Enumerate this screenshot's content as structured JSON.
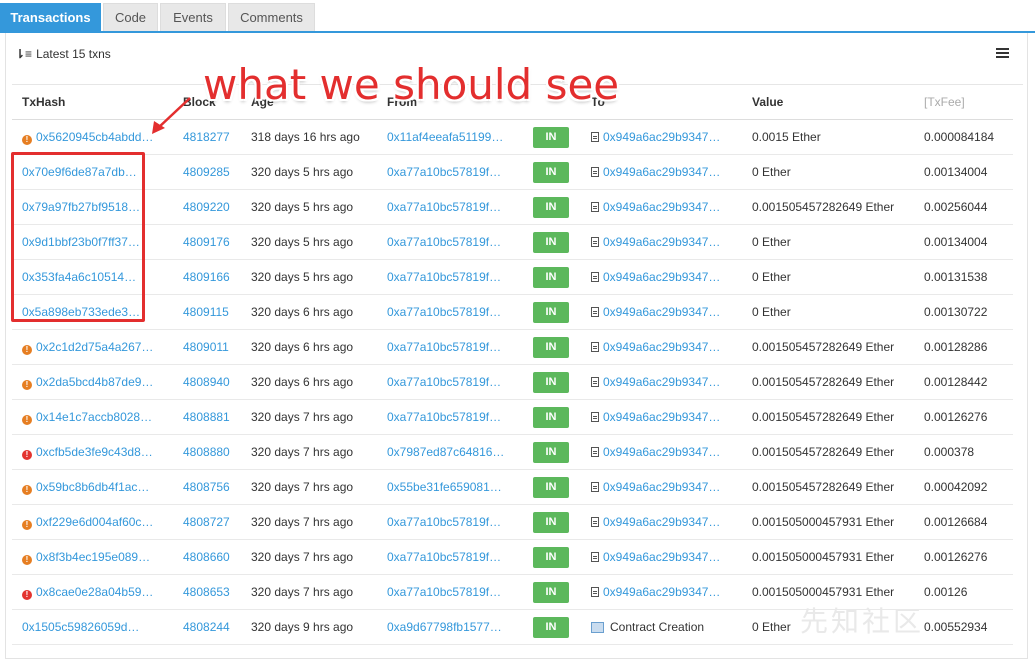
{
  "tabs": [
    {
      "label": "Transactions",
      "active": true
    },
    {
      "label": "Code",
      "active": false
    },
    {
      "label": "Events",
      "active": false
    },
    {
      "label": "Comments",
      "active": false
    }
  ],
  "latest_label": "Latest 15 txns",
  "columns": [
    "TxHash",
    "Block",
    "Age",
    "From",
    "",
    "To",
    "Value",
    "[TxFee]"
  ],
  "rows": [
    {
      "status": "orange",
      "hash": "0x5620945cb4abdd…",
      "block": "4818277",
      "age": "318 days 16 hrs ago",
      "from": "0x11af4eeafa51199…",
      "dir": "IN",
      "to": "0x949a6ac29b9347…",
      "value": "0.0015 Ether",
      "fee": "0.000084184"
    },
    {
      "status": "",
      "hash": "0x70e9f6de87a7db…",
      "block": "4809285",
      "age": "320 days 5 hrs ago",
      "from": "0xa77a10bc57819f…",
      "dir": "IN",
      "to": "0x949a6ac29b9347…",
      "value": "0 Ether",
      "fee": "0.00134004"
    },
    {
      "status": "",
      "hash": "0x79a97fb27bf9518…",
      "block": "4809220",
      "age": "320 days 5 hrs ago",
      "from": "0xa77a10bc57819f…",
      "dir": "IN",
      "to": "0x949a6ac29b9347…",
      "value": "0.001505457282649 Ether",
      "fee": "0.00256044"
    },
    {
      "status": "",
      "hash": "0x9d1bbf23b0f7ff37…",
      "block": "4809176",
      "age": "320 days 5 hrs ago",
      "from": "0xa77a10bc57819f…",
      "dir": "IN",
      "to": "0x949a6ac29b9347…",
      "value": "0 Ether",
      "fee": "0.00134004"
    },
    {
      "status": "",
      "hash": "0x353fa4a6c10514…",
      "block": "4809166",
      "age": "320 days 5 hrs ago",
      "from": "0xa77a10bc57819f…",
      "dir": "IN",
      "to": "0x949a6ac29b9347…",
      "value": "0 Ether",
      "fee": "0.00131538"
    },
    {
      "status": "",
      "hash": "0x5a898eb733ede3…",
      "block": "4809115",
      "age": "320 days 6 hrs ago",
      "from": "0xa77a10bc57819f…",
      "dir": "IN",
      "to": "0x949a6ac29b9347…",
      "value": "0 Ether",
      "fee": "0.00130722"
    },
    {
      "status": "orange",
      "hash": "0x2c1d2d75a4a267…",
      "block": "4809011",
      "age": "320 days 6 hrs ago",
      "from": "0xa77a10bc57819f…",
      "dir": "IN",
      "to": "0x949a6ac29b9347…",
      "value": "0.001505457282649 Ether",
      "fee": "0.00128286"
    },
    {
      "status": "orange",
      "hash": "0x2da5bcd4b87de9…",
      "block": "4808940",
      "age": "320 days 6 hrs ago",
      "from": "0xa77a10bc57819f…",
      "dir": "IN",
      "to": "0x949a6ac29b9347…",
      "value": "0.001505457282649 Ether",
      "fee": "0.00128442"
    },
    {
      "status": "orange",
      "hash": "0x14e1c7accb8028…",
      "block": "4808881",
      "age": "320 days 7 hrs ago",
      "from": "0xa77a10bc57819f…",
      "dir": "IN",
      "to": "0x949a6ac29b9347…",
      "value": "0.001505457282649 Ether",
      "fee": "0.00126276"
    },
    {
      "status": "red",
      "hash": "0xcfb5de3fe9c43d8…",
      "block": "4808880",
      "age": "320 days 7 hrs ago",
      "from": "0x7987ed87c64816…",
      "dir": "IN",
      "to": "0x949a6ac29b9347…",
      "value": "0.001505457282649 Ether",
      "fee": "0.000378"
    },
    {
      "status": "orange",
      "hash": "0x59bc8b6db4f1ac…",
      "block": "4808756",
      "age": "320 days 7 hrs ago",
      "from": "0x55be31fe659081…",
      "dir": "IN",
      "to": "0x949a6ac29b9347…",
      "value": "0.001505457282649 Ether",
      "fee": "0.00042092"
    },
    {
      "status": "orange",
      "hash": "0xf229e6d004af60c…",
      "block": "4808727",
      "age": "320 days 7 hrs ago",
      "from": "0xa77a10bc57819f…",
      "dir": "IN",
      "to": "0x949a6ac29b9347…",
      "value": "0.001505000457931 Ether",
      "fee": "0.00126684"
    },
    {
      "status": "orange",
      "hash": "0x8f3b4ec195e089…",
      "block": "4808660",
      "age": "320 days 7 hrs ago",
      "from": "0xa77a10bc57819f…",
      "dir": "IN",
      "to": "0x949a6ac29b9347…",
      "value": "0.001505000457931 Ether",
      "fee": "0.00126276"
    },
    {
      "status": "red",
      "hash": "0x8cae0e28a04b59…",
      "block": "4808653",
      "age": "320 days 7 hrs ago",
      "from": "0xa77a10bc57819f…",
      "dir": "IN",
      "to": "0x949a6ac29b9347…",
      "value": "0.001505000457931 Ether",
      "fee": "0.00126"
    },
    {
      "status": "",
      "hash": "0x1505c59826059d…",
      "block": "4808244",
      "age": "320 days 9 hrs ago",
      "from": "0xa9d67798fb1577…",
      "dir": "IN",
      "to": "Contract Creation",
      "to_is_contract_creation": true,
      "value": "0 Ether",
      "fee": "0.00552934"
    }
  ],
  "annotation": {
    "text": "what we should see",
    "color": "#e32e2e"
  },
  "watermark": "先知社区",
  "colors": {
    "accent": "#3498db",
    "in_badge": "#5cb85c",
    "error_orange": "#e67e22",
    "error_red": "#e3342f"
  }
}
